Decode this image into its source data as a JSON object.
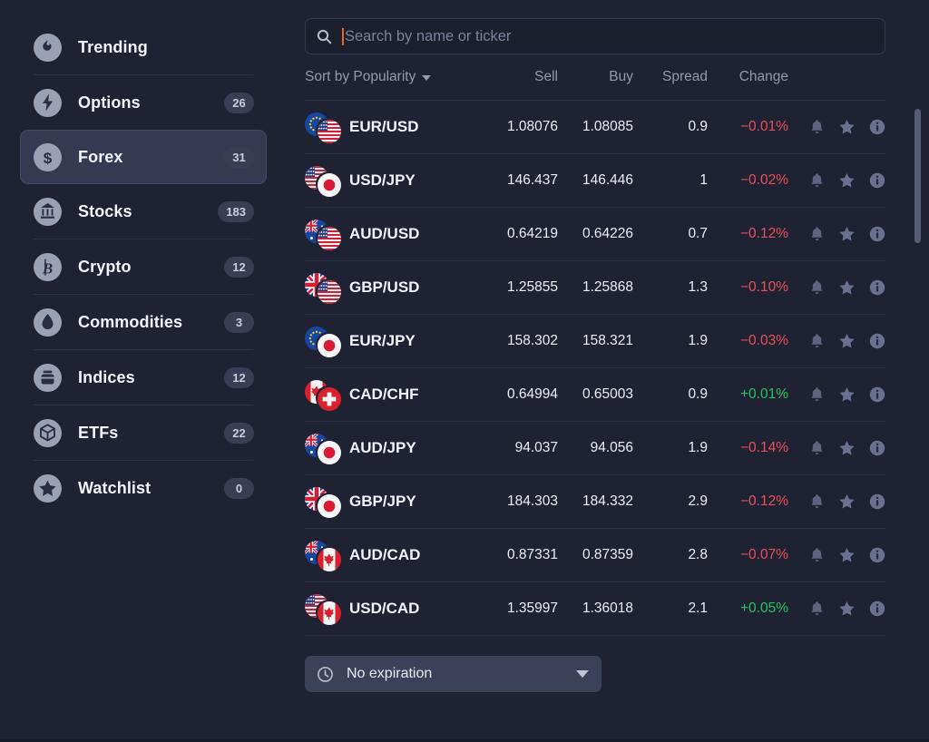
{
  "sidebar": {
    "items": [
      {
        "label": "Trending",
        "badge": "",
        "icon": "flame-icon",
        "active": false,
        "divider_after": true
      },
      {
        "label": "Options",
        "badge": "26",
        "icon": "bolt-icon",
        "active": false,
        "divider_after": false
      },
      {
        "label": "Forex",
        "badge": "31",
        "icon": "dollar-icon",
        "active": true,
        "divider_after": false
      },
      {
        "label": "Stocks",
        "badge": "183",
        "icon": "bank-icon",
        "active": false,
        "divider_after": true
      },
      {
        "label": "Crypto",
        "badge": "12",
        "icon": "bitcoin-icon",
        "active": false,
        "divider_after": true
      },
      {
        "label": "Commodities",
        "badge": "3",
        "icon": "droplet-icon",
        "active": false,
        "divider_after": true
      },
      {
        "label": "Indices",
        "badge": "12",
        "icon": "indices-icon",
        "active": false,
        "divider_after": true
      },
      {
        "label": "ETFs",
        "badge": "22",
        "icon": "cube-icon",
        "active": false,
        "divider_after": true
      },
      {
        "label": "Watchlist",
        "badge": "0",
        "icon": "star-icon",
        "active": false,
        "divider_after": false
      }
    ]
  },
  "search": {
    "placeholder": "Search by name or ticker",
    "value": "",
    "icon": "search-icon",
    "caret_color": "#f06321"
  },
  "table": {
    "sort_label": "Sort by Popularity",
    "columns": {
      "sell": "Sell",
      "buy": "Buy",
      "spread": "Spread",
      "change": "Change"
    },
    "row_actions": [
      "alert-bell-icon",
      "favorite-star-icon",
      "info-icon"
    ],
    "colors": {
      "up": "#22c55e",
      "down": "#e8505b"
    },
    "rows": [
      {
        "pair": "EUR/USD",
        "base": "EU",
        "quote": "US",
        "sell": "1.08076",
        "buy": "1.08085",
        "spread": "0.9",
        "change": "−0.01%",
        "dir": "down"
      },
      {
        "pair": "USD/JPY",
        "base": "US",
        "quote": "JP",
        "sell": "146.437",
        "buy": "146.446",
        "spread": "1",
        "change": "−0.02%",
        "dir": "down"
      },
      {
        "pair": "AUD/USD",
        "base": "AU",
        "quote": "US",
        "sell": "0.64219",
        "buy": "0.64226",
        "spread": "0.7",
        "change": "−0.12%",
        "dir": "down"
      },
      {
        "pair": "GBP/USD",
        "base": "GB",
        "quote": "US",
        "sell": "1.25855",
        "buy": "1.25868",
        "spread": "1.3",
        "change": "−0.10%",
        "dir": "down"
      },
      {
        "pair": "EUR/JPY",
        "base": "EU",
        "quote": "JP",
        "sell": "158.302",
        "buy": "158.321",
        "spread": "1.9",
        "change": "−0.03%",
        "dir": "down"
      },
      {
        "pair": "CAD/CHF",
        "base": "CA",
        "quote": "CH",
        "sell": "0.64994",
        "buy": "0.65003",
        "spread": "0.9",
        "change": "+0.01%",
        "dir": "up"
      },
      {
        "pair": "AUD/JPY",
        "base": "AU",
        "quote": "JP",
        "sell": "94.037",
        "buy": "94.056",
        "spread": "1.9",
        "change": "−0.14%",
        "dir": "down"
      },
      {
        "pair": "GBP/JPY",
        "base": "GB",
        "quote": "JP",
        "sell": "184.303",
        "buy": "184.332",
        "spread": "2.9",
        "change": "−0.12%",
        "dir": "down"
      },
      {
        "pair": "AUD/CAD",
        "base": "AU",
        "quote": "CA",
        "sell": "0.87331",
        "buy": "0.87359",
        "spread": "2.8",
        "change": "−0.07%",
        "dir": "down"
      },
      {
        "pair": "USD/CAD",
        "base": "US",
        "quote": "CA",
        "sell": "1.35997",
        "buy": "1.36018",
        "spread": "2.1",
        "change": "+0.05%",
        "dir": "up"
      }
    ]
  },
  "expiration": {
    "label": "No expiration",
    "icon": "clock-icon"
  }
}
